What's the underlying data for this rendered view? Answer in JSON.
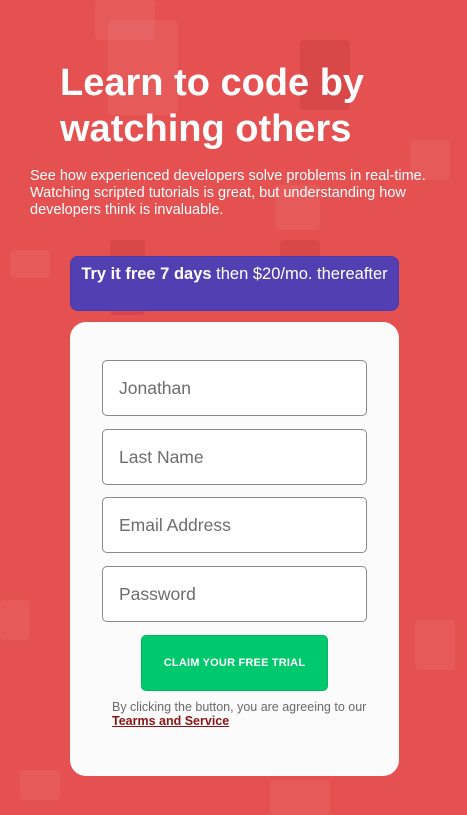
{
  "hero": {
    "title": "Learn to code by watching others",
    "subtitle": "See how experienced developers solve problems in real-time. Watching scripted tutorials is great, but understanding how developers think is invaluable."
  },
  "trial_banner": {
    "bold_text": "Try it free 7 days",
    "rest_text": " then $20/mo. thereafter"
  },
  "form": {
    "first_name": {
      "value": "",
      "placeholder": "Jonathan"
    },
    "last_name": {
      "value": "",
      "placeholder": "Last Name"
    },
    "email": {
      "value": "",
      "placeholder": "Email Address"
    },
    "password": {
      "value": "",
      "placeholder": "Password"
    },
    "submit_label": "CLAIM YOUR FREE TRIAL",
    "disclaimer_text": "By clicking the button, you are agreeing to our ",
    "terms_link": "Tearms and Service"
  },
  "colors": {
    "background": "#e55050",
    "banner": "#5240b3",
    "button": "#00c86c",
    "terms_link": "#8b1414"
  }
}
